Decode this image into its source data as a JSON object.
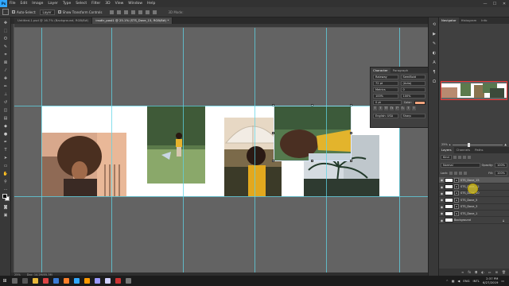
{
  "menubar": {
    "logo": "Ps",
    "items": [
      "File",
      "Edit",
      "Image",
      "Layer",
      "Type",
      "Select",
      "Filter",
      "3D",
      "View",
      "Window",
      "Help"
    ],
    "window_controls": [
      "—",
      "☐",
      "✕"
    ]
  },
  "options_bar": {
    "auto_select_label": "Auto-Select:",
    "auto_select_target": "Layer",
    "show_transform_label": "Show Transform Controls",
    "mode_3d_label": "3D Mode:"
  },
  "tabs": [
    {
      "label": "Untitled-1.psd @ 16.7% (Background, RGB/8#)",
      "active": false
    },
    {
      "label": "insdtr_post1 @ 25.1% (STS_Dove_15, RGB/8#) *",
      "active": true
    },
    {
      "label": "",
      "active": false
    }
  ],
  "status_bar": {
    "zoom": "25%",
    "doc_size": "Doc: 14.2M/55.3M"
  },
  "character_panel": {
    "tabs": [
      "Character",
      "Paragraph"
    ],
    "font_family": "Raleway",
    "font_style": "SemiBold",
    "font_size": "72 pt",
    "leading": "(Auto)",
    "kerning": "Metrics",
    "tracking": "0",
    "vertical_scale": "100%",
    "horizontal_scale": "100%",
    "baseline_shift": "0 pt",
    "color_label": "Color:",
    "style_buttons": [
      "T",
      "T",
      "TT",
      "Tt",
      "T¹",
      "T₁",
      "T",
      "T"
    ],
    "language": "English: USA",
    "antialias": "Sharp",
    "text_color": "#f1a37c"
  },
  "right_panels": {
    "tabs": [
      "Navigator",
      "Histogram",
      "Info"
    ],
    "zoom_value": "25%"
  },
  "layers_panel": {
    "tabs": [
      "Layers",
      "Channels",
      "Paths"
    ],
    "filter_kind": "Kind",
    "blend_mode": "Normal",
    "opacity_label": "Opacity:",
    "opacity": "100%",
    "lock_label": "Lock:",
    "fill_label": "Fill:",
    "fill": "100%",
    "layers": [
      {
        "name": "STS_Dove_15",
        "selected": true,
        "locked": false
      },
      {
        "name": "STS_Dove_12",
        "selected": false,
        "locked": false
      },
      {
        "name": "STS_Dove_10",
        "selected": false,
        "locked": false
      },
      {
        "name": "STS_Dove_5",
        "selected": false,
        "locked": false
      },
      {
        "name": "STS_Dove_3",
        "selected": false,
        "locked": false
      },
      {
        "name": "STS_Dove_1",
        "selected": false,
        "locked": false
      },
      {
        "name": "Background",
        "selected": false,
        "locked": true
      }
    ],
    "footer_icons": [
      "link-icon",
      "fx-icon",
      "mask-icon",
      "adjustment-icon",
      "folder-icon",
      "new-layer-icon",
      "trash-icon"
    ]
  },
  "taskbar": {
    "tray_lang": "ENG",
    "tray_region": "INTL",
    "time": "2:37 PM",
    "date": "6/27/2019"
  },
  "colors": {
    "accent": "#31a8ff",
    "guide": "#5fd4e6",
    "cursor_highlight": "#dcc828"
  }
}
